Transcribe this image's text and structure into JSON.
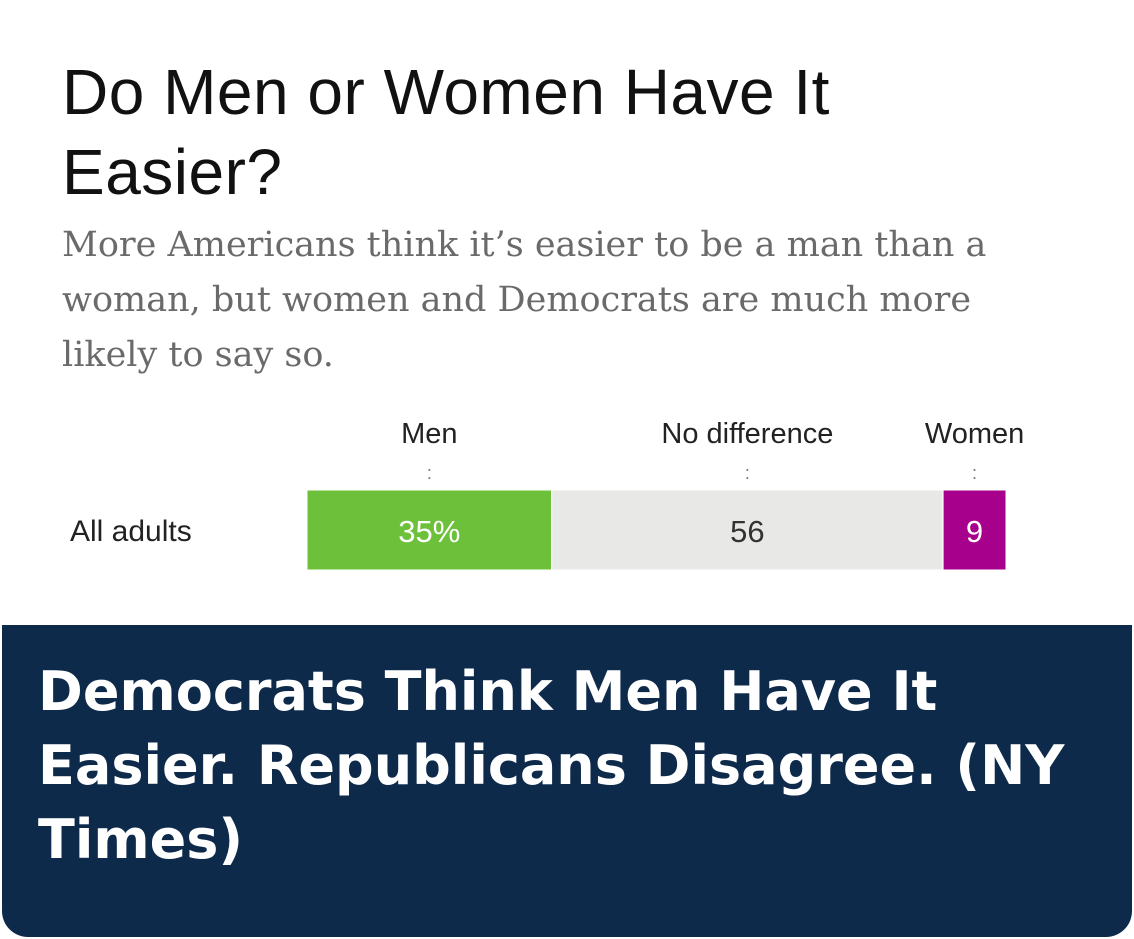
{
  "title": "Do Men or Women Have It Easier?",
  "subtitle": "More Americans think it’s easier to be a man than a woman, but women and Democrats are much more likely to say so.",
  "chart_data": {
    "type": "bar",
    "orientation": "horizontal-stacked",
    "categories": [
      "All adults"
    ],
    "series": [
      {
        "name": "Men",
        "values": [
          35
        ],
        "label": "35%",
        "color": "#6cc03a",
        "text_color": "#ffffff"
      },
      {
        "name": "No difference",
        "values": [
          56
        ],
        "label": "56",
        "color": "#e8e8e6",
        "text_color": "#333333"
      },
      {
        "name": "Women",
        "values": [
          9
        ],
        "label": "9",
        "color": "#a7008c",
        "text_color": "#ffffff"
      }
    ],
    "total": 100,
    "legend_marker": ":"
  },
  "banner": {
    "text": "Democrats Think Men Have It Easier. Republicans Disagree. (NY Times)",
    "background": "#0e2a4b"
  }
}
